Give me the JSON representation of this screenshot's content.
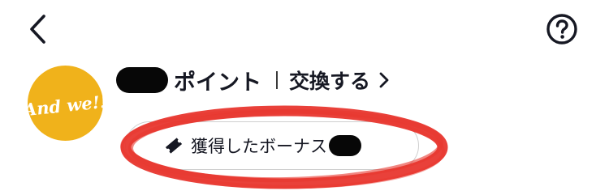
{
  "header": {
    "back_icon": "chevron-left-icon",
    "help_icon": "help-circle-icon"
  },
  "profile": {
    "avatar_text": "And we!!",
    "avatar_color": "#f0b21b"
  },
  "points": {
    "label": "ポイント",
    "exchange_label": "交換する",
    "exchange_icon": "chevron-right-icon"
  },
  "bonus": {
    "label": "獲得したボーナス",
    "icon": "ticket-icon"
  },
  "annotation": {
    "color": "#e8372f"
  }
}
